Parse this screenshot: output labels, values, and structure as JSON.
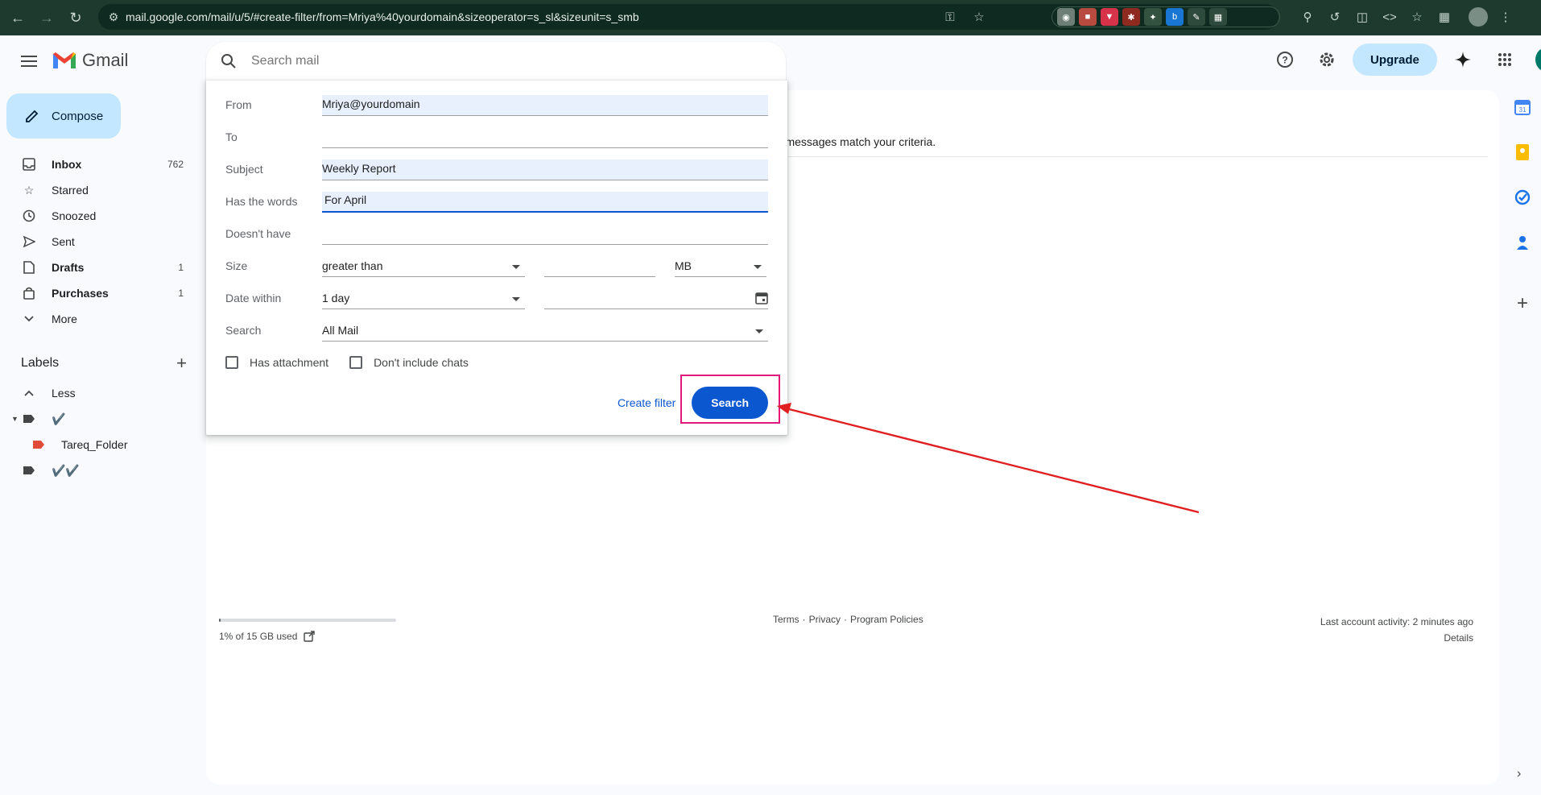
{
  "browser": {
    "url": "mail.google.com/mail/u/5/#create-filter/from=Mriya%40yourdomain&sizeoperator=s_sl&sizeunit=s_smb"
  },
  "header": {
    "app_name": "Gmail",
    "search_placeholder": "Search mail",
    "upgrade_label": "Upgrade",
    "avatar_letter": "T"
  },
  "sidebar": {
    "compose_label": "Compose",
    "items": [
      {
        "label": "Inbox",
        "count": "762",
        "icon": "inbox-icon",
        "bold": true
      },
      {
        "label": "Starred",
        "count": "",
        "icon": "star-icon",
        "bold": false
      },
      {
        "label": "Snoozed",
        "count": "",
        "icon": "clock-icon",
        "bold": false
      },
      {
        "label": "Sent",
        "count": "",
        "icon": "send-icon",
        "bold": false
      },
      {
        "label": "Drafts",
        "count": "1",
        "icon": "draft-icon",
        "bold": true
      },
      {
        "label": "Purchases",
        "count": "1",
        "icon": "bag-icon",
        "bold": true
      },
      {
        "label": "More",
        "count": "",
        "icon": "chevron-down-icon",
        "bold": false
      }
    ],
    "labels_title": "Labels",
    "labels": [
      {
        "label": "Less"
      },
      {
        "label": "✔️"
      },
      {
        "label": "Tareq_Folder"
      },
      {
        "label": "✔️✔️"
      }
    ]
  },
  "advanced_search": {
    "from_label": "From",
    "from_value": "Mriya@yourdomain",
    "to_label": "To",
    "to_value": "",
    "subject_label": "Subject",
    "subject_value": "Weekly Report",
    "has_words_label": "Has the words",
    "has_words_value": "For April",
    "doesnt_have_label": "Doesn't have",
    "doesnt_have_value": "",
    "size_label": "Size",
    "size_operator": "greater than",
    "size_value": "",
    "size_unit": "MB",
    "date_label": "Date within",
    "date_value": "1 day",
    "date_field_value": "",
    "search_label": "Search",
    "search_scope": "All Mail",
    "has_attachment_label": "Has attachment",
    "no_chats_label": "Don't include chats",
    "create_filter_label": "Create filter",
    "search_button_label": "Search"
  },
  "main": {
    "no_match_text": "ng messages match your criteria.",
    "storage_text": "1% of 15 GB used",
    "storage_fraction": 0.01,
    "footer_links": [
      "Terms",
      "·",
      "Privacy",
      "·",
      "Program Policies"
    ],
    "last_activity": "Last account activity: 2 minutes ago",
    "details_label": "Details"
  },
  "colors": {
    "accent": "#0b57d0",
    "compose_bg": "#c2e7ff",
    "highlight": "#e3187d",
    "arrow": "#e02020"
  }
}
